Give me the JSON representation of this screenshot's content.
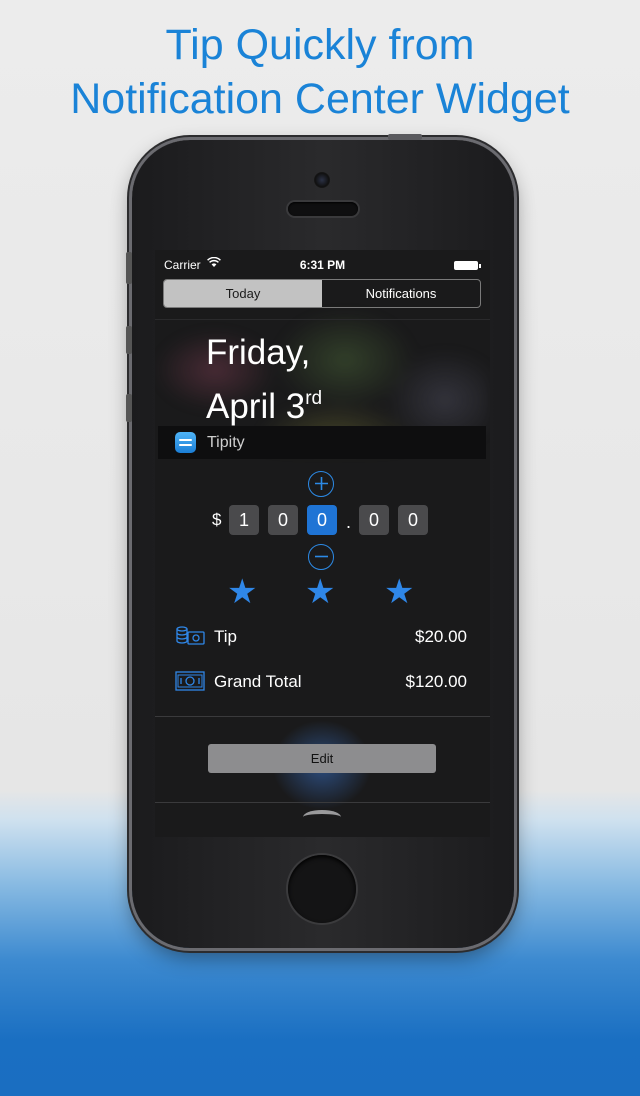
{
  "headline": {
    "line1": "Tip Quickly from",
    "line2": "Notification Center Widget"
  },
  "status_bar": {
    "carrier": "Carrier",
    "time": "6:31 PM"
  },
  "tabs": {
    "today": "Today",
    "notifications": "Notifications",
    "selected": "Today"
  },
  "date": {
    "weekday": "Friday,",
    "month_day": "April 3",
    "suffix": "rd"
  },
  "widget": {
    "app_name": "Tipity",
    "currency_symbol": "$",
    "digits": [
      "1",
      "0",
      "0",
      "0",
      "0"
    ],
    "selected_digit_index": 2,
    "decimal_separator": ".",
    "rating_stars": 3,
    "tip_label": "Tip",
    "tip_value": "$20.00",
    "total_label": "Grand Total",
    "total_value": "$120.00"
  },
  "edit_label": "Edit",
  "colors": {
    "headline": "#1a83d7",
    "accent": "#2c8ae6",
    "selected_digit": "#1f74d5"
  }
}
